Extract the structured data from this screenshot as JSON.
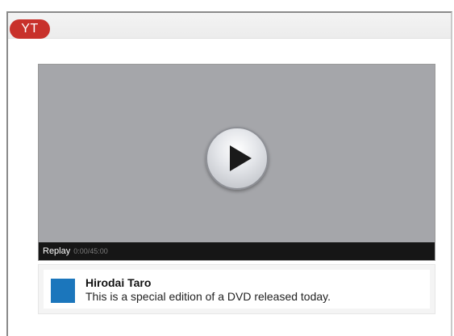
{
  "header": {
    "logo_text": "YT",
    "logo_color": "#c8312b"
  },
  "player": {
    "play_icon": "play-icon",
    "replay_label": "Replay",
    "time_display": "0:00/45:00"
  },
  "video_info": {
    "uploader_name": "Hirodai Taro",
    "description": "This is a special edition of a DVD released today.",
    "avatar_color": "#1b76bc"
  }
}
